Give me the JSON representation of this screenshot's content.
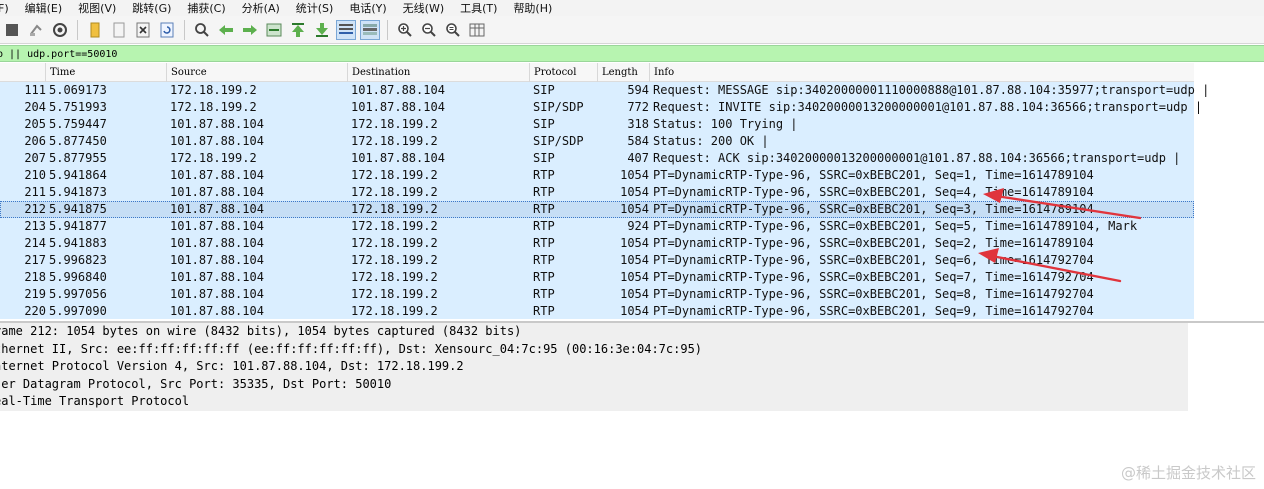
{
  "menubar": {
    "items": [
      "F)",
      "编辑(E)",
      "视图(V)",
      "跳转(G)",
      "捕获(C)",
      "分析(A)",
      "统计(S)",
      "电话(Y)",
      "无线(W)",
      "工具(T)",
      "帮助(H)"
    ]
  },
  "toolbar": {
    "icons": [
      "stop-icon",
      "restart-icon",
      "options-icon",
      "open-file-icon",
      "file-icon",
      "close-file-icon",
      "reload-icon",
      "find-icon",
      "back-icon",
      "forward-icon",
      "go-to-packet-icon",
      "first-packet-icon",
      "last-packet-icon",
      "autoscroll-icon",
      "colorize-icon",
      "zoom-in-icon",
      "zoom-out-icon",
      "normal-size-icon",
      "resize-columns-icon"
    ]
  },
  "filter": {
    "value": "p || udp.port==50010"
  },
  "packet_list": {
    "columns": [
      "",
      "Time",
      "Source",
      "Destination",
      "Protocol",
      "Length",
      "Info"
    ],
    "rows": [
      {
        "no": "111",
        "time": "5.069173",
        "src": "172.18.199.2",
        "dst": "101.87.88.104",
        "proto": "SIP",
        "len": "594",
        "info": "Request: MESSAGE sip:34020000001110000888@101.87.88.104:35977;transport=udp |"
      },
      {
        "no": "204",
        "time": "5.751993",
        "src": "172.18.199.2",
        "dst": "101.87.88.104",
        "proto": "SIP/SDP",
        "len": "772",
        "info": "Request: INVITE sip:34020000013200000001@101.87.88.104:36566;transport=udp |"
      },
      {
        "no": "205",
        "time": "5.759447",
        "src": "101.87.88.104",
        "dst": "172.18.199.2",
        "proto": "SIP",
        "len": "318",
        "info": "Status: 100 Trying |"
      },
      {
        "no": "206",
        "time": "5.877450",
        "src": "101.87.88.104",
        "dst": "172.18.199.2",
        "proto": "SIP/SDP",
        "len": "584",
        "info": "Status: 200 OK |"
      },
      {
        "no": "207",
        "time": "5.877955",
        "src": "172.18.199.2",
        "dst": "101.87.88.104",
        "proto": "SIP",
        "len": "407",
        "info": "Request: ACK sip:34020000013200000001@101.87.88.104:36566;transport=udp |"
      },
      {
        "no": "210",
        "time": "5.941864",
        "src": "101.87.88.104",
        "dst": "172.18.199.2",
        "proto": "RTP",
        "len": "1054",
        "info": "PT=DynamicRTP-Type-96, SSRC=0xBEBC201, Seq=1, Time=1614789104"
      },
      {
        "no": "211",
        "time": "5.941873",
        "src": "101.87.88.104",
        "dst": "172.18.199.2",
        "proto": "RTP",
        "len": "1054",
        "info": "PT=DynamicRTP-Type-96, SSRC=0xBEBC201, Seq=4, Time=1614789104"
      },
      {
        "no": "212",
        "time": "5.941875",
        "src": "101.87.88.104",
        "dst": "172.18.199.2",
        "proto": "RTP",
        "len": "1054",
        "info": "PT=DynamicRTP-Type-96, SSRC=0xBEBC201, Seq=3, Time=1614789104",
        "selected": true
      },
      {
        "no": "213",
        "time": "5.941877",
        "src": "101.87.88.104",
        "dst": "172.18.199.2",
        "proto": "RTP",
        "len": "924",
        "info": "PT=DynamicRTP-Type-96, SSRC=0xBEBC201, Seq=5, Time=1614789104, Mark"
      },
      {
        "no": "214",
        "time": "5.941883",
        "src": "101.87.88.104",
        "dst": "172.18.199.2",
        "proto": "RTP",
        "len": "1054",
        "info": "PT=DynamicRTP-Type-96, SSRC=0xBEBC201, Seq=2, Time=1614789104"
      },
      {
        "no": "217",
        "time": "5.996823",
        "src": "101.87.88.104",
        "dst": "172.18.199.2",
        "proto": "RTP",
        "len": "1054",
        "info": "PT=DynamicRTP-Type-96, SSRC=0xBEBC201, Seq=6, Time=1614792704"
      },
      {
        "no": "218",
        "time": "5.996840",
        "src": "101.87.88.104",
        "dst": "172.18.199.2",
        "proto": "RTP",
        "len": "1054",
        "info": "PT=DynamicRTP-Type-96, SSRC=0xBEBC201, Seq=7, Time=1614792704"
      },
      {
        "no": "219",
        "time": "5.997056",
        "src": "101.87.88.104",
        "dst": "172.18.199.2",
        "proto": "RTP",
        "len": "1054",
        "info": "PT=DynamicRTP-Type-96, SSRC=0xBEBC201, Seq=8, Time=1614792704"
      },
      {
        "no": "220",
        "time": "5.997090",
        "src": "101.87.88.104",
        "dst": "172.18.199.2",
        "proto": "RTP",
        "len": "1054",
        "info": "PT=DynamicRTP-Type-96, SSRC=0xBEBC201, Seq=9, Time=1614792704"
      }
    ]
  },
  "details": {
    "lines": [
      "rame 212: 1054 bytes on wire (8432 bits), 1054 bytes captured (8432 bits)",
      "thernet II, Src: ee:ff:ff:ff:ff:ff (ee:ff:ff:ff:ff:ff), Dst: Xensourc_04:7c:95 (00:16:3e:04:7c:95)",
      "nternet Protocol Version 4, Src: 101.87.88.104, Dst: 172.18.199.2",
      "ser Datagram Protocol, Src Port: 35335, Dst Port: 50010",
      "eal-Time Transport Protocol"
    ]
  },
  "annotation_color": "#e0343c",
  "watermark": "@稀土掘金技术社区"
}
